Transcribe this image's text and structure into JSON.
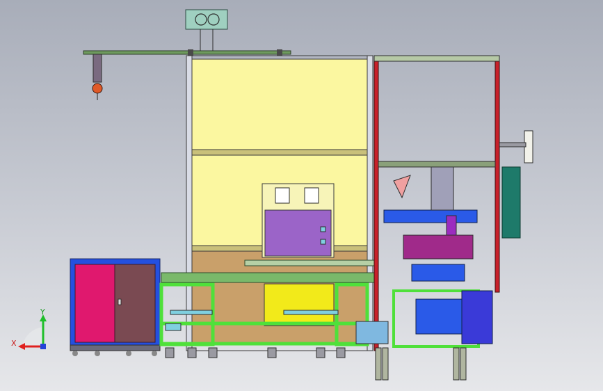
{
  "viewport": {
    "background_top": "#a8adb9",
    "background_bottom": "#e6e7ea"
  },
  "triad": {
    "x_label": "X",
    "y_label": "Y",
    "x_color": "#e0201f",
    "y_color": "#1fbf2a",
    "z_color": "#2343d8"
  },
  "colors": {
    "frame_yellow": "#fbf7a0",
    "panel_purple": "#9b64c8",
    "cabinet_pink": "#e0186e",
    "cabinet_brown": "#7a4a52",
    "cabinet_blue": "#2450e0",
    "frame_green": "#4fe03a",
    "frame_red": "#c8202a",
    "module_blue": "#2a5ae8",
    "module_teal": "#1e7a6a",
    "base_tan": "#c9a06a"
  }
}
